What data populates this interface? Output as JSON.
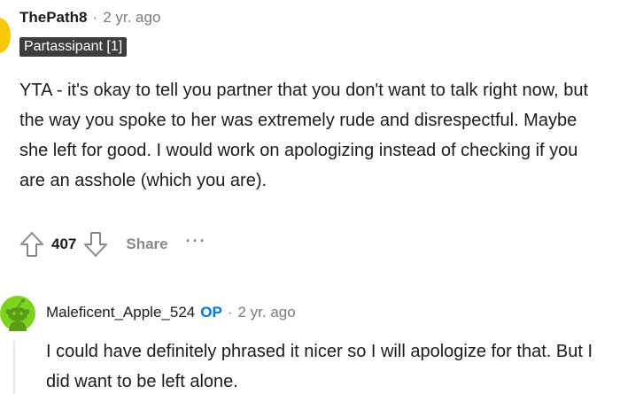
{
  "comments": [
    {
      "author": "ThePath8",
      "separator": "·",
      "timestamp": "2 yr. ago",
      "flair": "Partassipant [1]",
      "avatar_color": "#f6c90e",
      "body": "YTA - it's okay to tell you partner that you don't want to talk right now, but the way you spoke to her was extremely rude and disrespectful. Maybe she left for good. I would work on apologizing instead of checking if you are an asshole (which you are).",
      "actions": {
        "upvote_icon": "arrow-up-outline-icon",
        "score": "407",
        "downvote_icon": "arrow-down-outline-icon",
        "share_label": "Share",
        "more_label": "···"
      }
    },
    {
      "author": "Maleficent_Apple_524",
      "op_badge": "OP",
      "separator": "·",
      "timestamp": "2 yr. ago",
      "avatar_icon": "snoo-avatar-icon",
      "avatar_color": "#7ed321",
      "body": "I could have definitely phrased it nicer so I will apologize for that. But I did want to be left alone."
    }
  ],
  "colors": {
    "op_blue": "#0079d3",
    "meta_gray": "#7c7c7c",
    "flair_bg": "#3d3d3d"
  }
}
